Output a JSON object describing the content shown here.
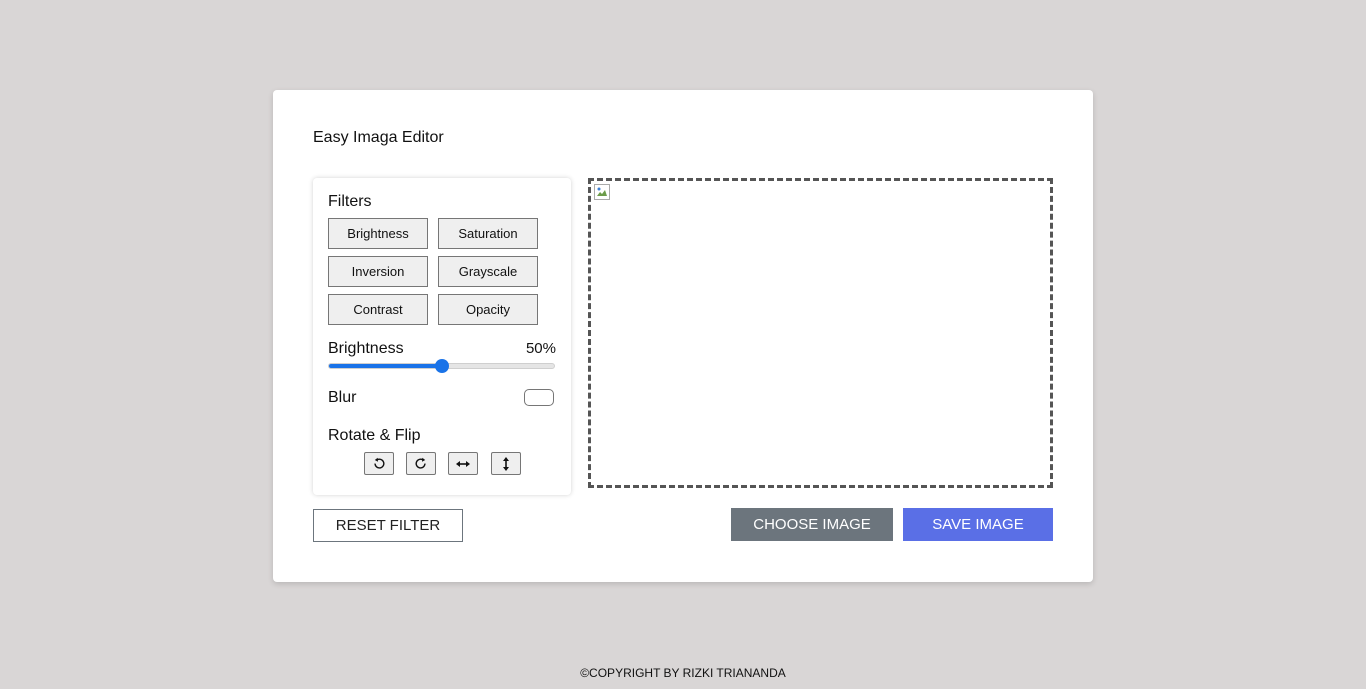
{
  "app": {
    "title": "Easy Imaga Editor"
  },
  "filters": {
    "label": "Filters",
    "buttons": [
      "Brightness",
      "Saturation",
      "Inversion",
      "Grayscale",
      "Contrast",
      "Opacity"
    ]
  },
  "slider": {
    "label": "Brightness",
    "value": 50,
    "value_text": "50%",
    "accent_color": "#1a73e8"
  },
  "blur": {
    "label": "Blur"
  },
  "rotate": {
    "label": "Rotate & Flip",
    "buttons": [
      "rotate-left-icon",
      "rotate-right-icon",
      "flip-horizontal-icon",
      "flip-vertical-icon"
    ]
  },
  "actions": {
    "reset_label": "RESET FILTER",
    "choose_label": "CHOOSE IMAGE",
    "save_label": "SAVE IMAGE",
    "choose_color": "#6c757d",
    "save_color": "#5a6fe6"
  },
  "footer": {
    "text": "©COPYRIGHT BY RIZKI TRIANANDA"
  }
}
